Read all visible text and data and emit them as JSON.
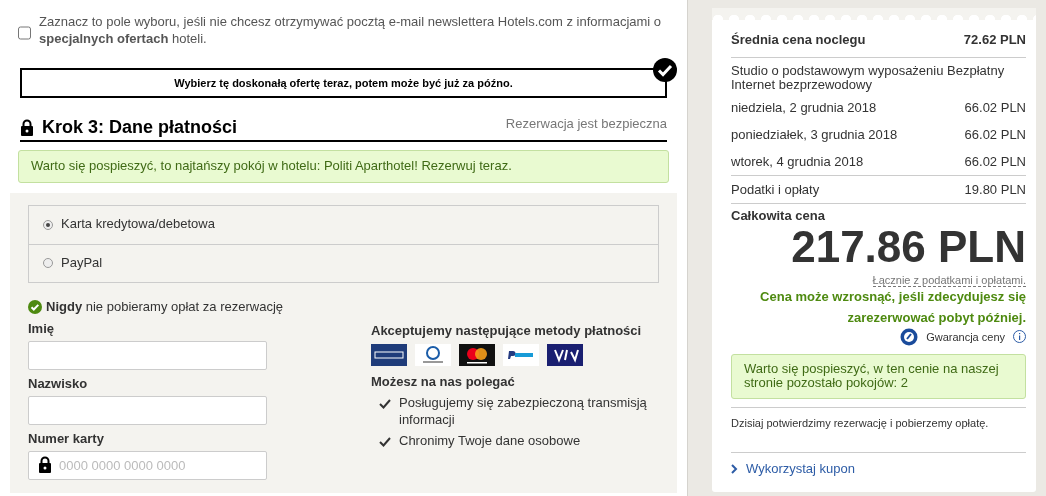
{
  "newsletter": {
    "checked": false,
    "text": "Zaznacz to pole wyboru, jeśli nie chcesz otrzymywać pocztą e-mail newslettera Hotels.com z informacjami o **specjalnych ofertach** hoteli."
  },
  "offer_banner": {
    "text": "Wybierz tę doskonałą ofertę teraz, potem może być już za późno.",
    "checked": true
  },
  "step": {
    "title": "Krok 3: Dane płatności",
    "secure_note": "Rezerwacja jest bezpieczna"
  },
  "hurry_alert": "Warto się pospieszyć, to najtańszy pokój w hotelu: Politi Aparthotel! Rezerwuj teraz.",
  "payment_methods": [
    {
      "label": "Karta kredytowa/debetowa",
      "selected": true
    },
    {
      "label": "PayPal",
      "selected": false
    }
  ],
  "no_fee": "**Nigdy** nie pobieramy opłat za rezerwację",
  "fields": [
    {
      "label": "Imię",
      "kind": "text"
    },
    {
      "label": "Nazwisko",
      "kind": "text"
    },
    {
      "label": "Numer karty",
      "kind": "card",
      "placeholder": "0000 0000 0000 0000"
    }
  ],
  "accepted": {
    "title": "Akceptujemy następujące metody płatności",
    "cards": [
      {
        "kind": "amex"
      },
      {
        "kind": "diners"
      },
      {
        "kind": "mastercard"
      },
      {
        "kind": "paypal"
      },
      {
        "kind": "visa"
      }
    ]
  },
  "trust": {
    "title": "Możesz na nas polegać",
    "items": [
      "Posługujemy się zabezpieczoną transmisją informacji",
      "Chronimy Twoje dane osobowe"
    ]
  },
  "summary": {
    "avg_label": "Średnia cena noclegu",
    "avg_price": "72.62 PLN",
    "room": "Studio o podstawowym wyposażeniu Bezpłatny Internet bezprzewodowy",
    "nights": [
      {
        "date": "niedziela, 2 grudnia 2018",
        "price": "66.02 PLN"
      },
      {
        "date": "poniedziałek, 3 grudnia 2018",
        "price": "66.02 PLN"
      },
      {
        "date": "wtorek, 4 grudnia 2018",
        "price": "66.02 PLN"
      }
    ],
    "taxes_label": "Podatki i opłaty",
    "taxes": "19.80 PLN",
    "total_label": "Całkowita cena",
    "total": "217.86 PLN",
    "incl_note": "Łącznie z podatkami i opłatami.",
    "price_warning": "Cena może wzrosnąć, jeśli zdecydujesz się zarezerwować pobyt później.",
    "guarantee": "Gwarancja ceny",
    "rooms_alert": "Warto się pospieszyć, w ten cenie na naszej stronie pozostało pokojów: 2",
    "charge_note": "Dzisiaj potwierdzimy rezerwację i pobierzemy opłatę.",
    "coupon": "Wykorzystaj kupon"
  }
}
